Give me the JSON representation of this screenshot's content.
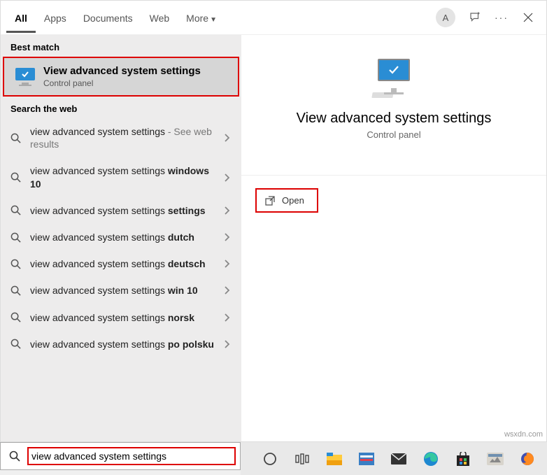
{
  "tabs": {
    "all": "All",
    "apps": "Apps",
    "documents": "Documents",
    "web": "Web",
    "more": "More"
  },
  "avatar": "A",
  "sections": {
    "best": "Best match",
    "web": "Search the web"
  },
  "best": {
    "title": "View advanced system settings",
    "subtitle": "Control panel"
  },
  "web_results": [
    {
      "text": "view advanced system settings",
      "extra": " - See web results",
      "bold": ""
    },
    {
      "text": "view advanced system settings ",
      "bold": "windows 10"
    },
    {
      "text": "view advanced system settings ",
      "bold": "settings"
    },
    {
      "text": "view advanced system settings ",
      "bold": "dutch"
    },
    {
      "text": "view advanced system settings ",
      "bold": "deutsch"
    },
    {
      "text": "view advanced system settings ",
      "bold": "win 10"
    },
    {
      "text": "view advanced system settings ",
      "bold": "norsk"
    },
    {
      "text": "view advanced system settings ",
      "bold": "po polsku"
    }
  ],
  "preview": {
    "title": "View advanced system settings",
    "subtitle": "Control panel",
    "open": "Open"
  },
  "search": {
    "value": "view advanced system settings"
  },
  "watermark": "wsxdn.com"
}
